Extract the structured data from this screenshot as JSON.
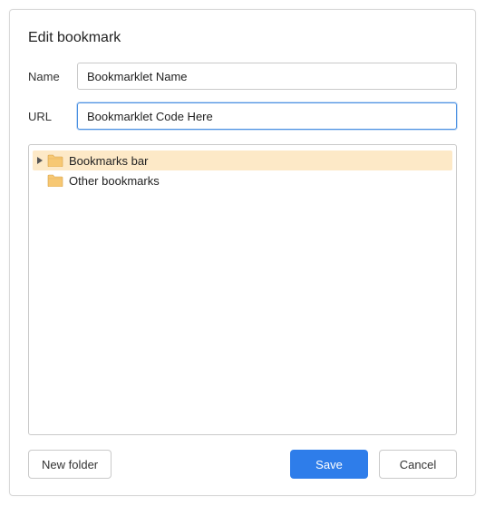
{
  "dialog": {
    "title": "Edit bookmark"
  },
  "form": {
    "name_label": "Name",
    "name_value": "Bookmarklet Name",
    "url_label": "URL",
    "url_value": "Bookmarklet Code Here"
  },
  "tree": {
    "items": [
      {
        "label": "Bookmarks bar",
        "expandable": true,
        "selected": true
      },
      {
        "label": "Other bookmarks",
        "expandable": false,
        "selected": false
      }
    ]
  },
  "buttons": {
    "new_folder": "New folder",
    "save": "Save",
    "cancel": "Cancel"
  }
}
